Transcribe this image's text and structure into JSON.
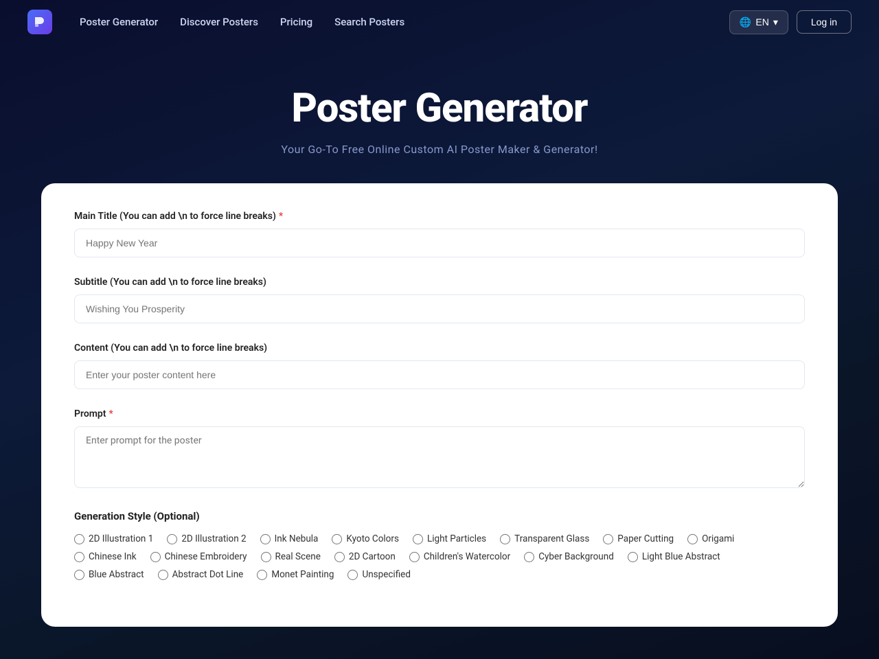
{
  "nav": {
    "logo_text": "P",
    "links": [
      {
        "label": "Poster Generator",
        "id": "poster-generator"
      },
      {
        "label": "Discover Posters",
        "id": "discover-posters"
      },
      {
        "label": "Pricing",
        "id": "pricing"
      },
      {
        "label": "Search Posters",
        "id": "search-posters"
      }
    ],
    "lang_label": "EN",
    "login_label": "Log in"
  },
  "hero": {
    "title": "Poster Generator",
    "subtitle": "Your Go-To Free Online Custom AI Poster Maker & Generator!"
  },
  "form": {
    "main_title_label": "Main Title (You can add \\n to force line breaks)",
    "main_title_required": "*",
    "main_title_placeholder": "Happy New Year",
    "subtitle_label": "Subtitle (You can add \\n to force line breaks)",
    "subtitle_placeholder": "Wishing You Prosperity",
    "content_label": "Content (You can add \\n to force line breaks)",
    "content_placeholder": "Enter your poster content here",
    "prompt_label": "Prompt",
    "prompt_required": "*",
    "prompt_placeholder": "Enter prompt for the poster",
    "generation_style_label": "Generation Style (Optional)",
    "style_options": [
      "2D Illustration 1",
      "2D Illustration 2",
      "Ink Nebula",
      "Kyoto Colors",
      "Light Particles",
      "Transparent Glass",
      "Paper Cutting",
      "Origami",
      "Chinese Ink",
      "Chinese Embroidery",
      "Real Scene",
      "2D Cartoon",
      "Children's Watercolor",
      "Cyber Background",
      "Light Blue Abstract",
      "Blue Abstract",
      "Abstract Dot Line",
      "Monet Painting",
      "Unspecified"
    ]
  }
}
